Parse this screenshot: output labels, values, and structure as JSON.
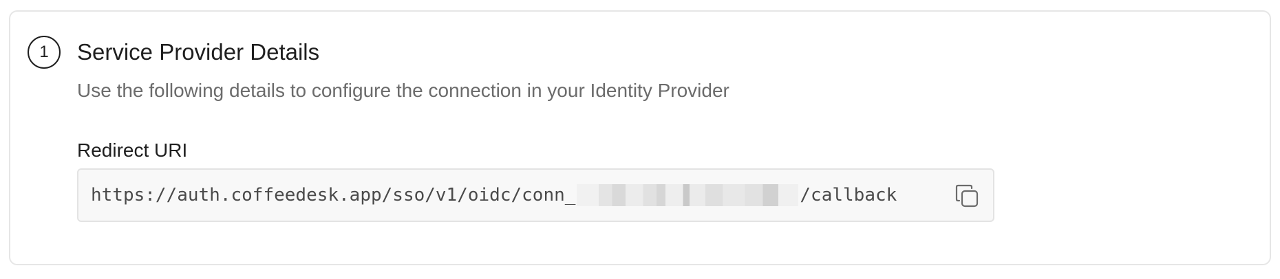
{
  "step": {
    "number": "1",
    "title": "Service Provider Details",
    "description": "Use the following details to configure the connection in your Identity Provider"
  },
  "redirect_uri": {
    "label": "Redirect URI",
    "value_prefix": "https://auth.coffeedesk.app/sso/v1/oidc/conn_",
    "value_suffix": "/callback",
    "copy_icon": "copy-icon"
  }
}
